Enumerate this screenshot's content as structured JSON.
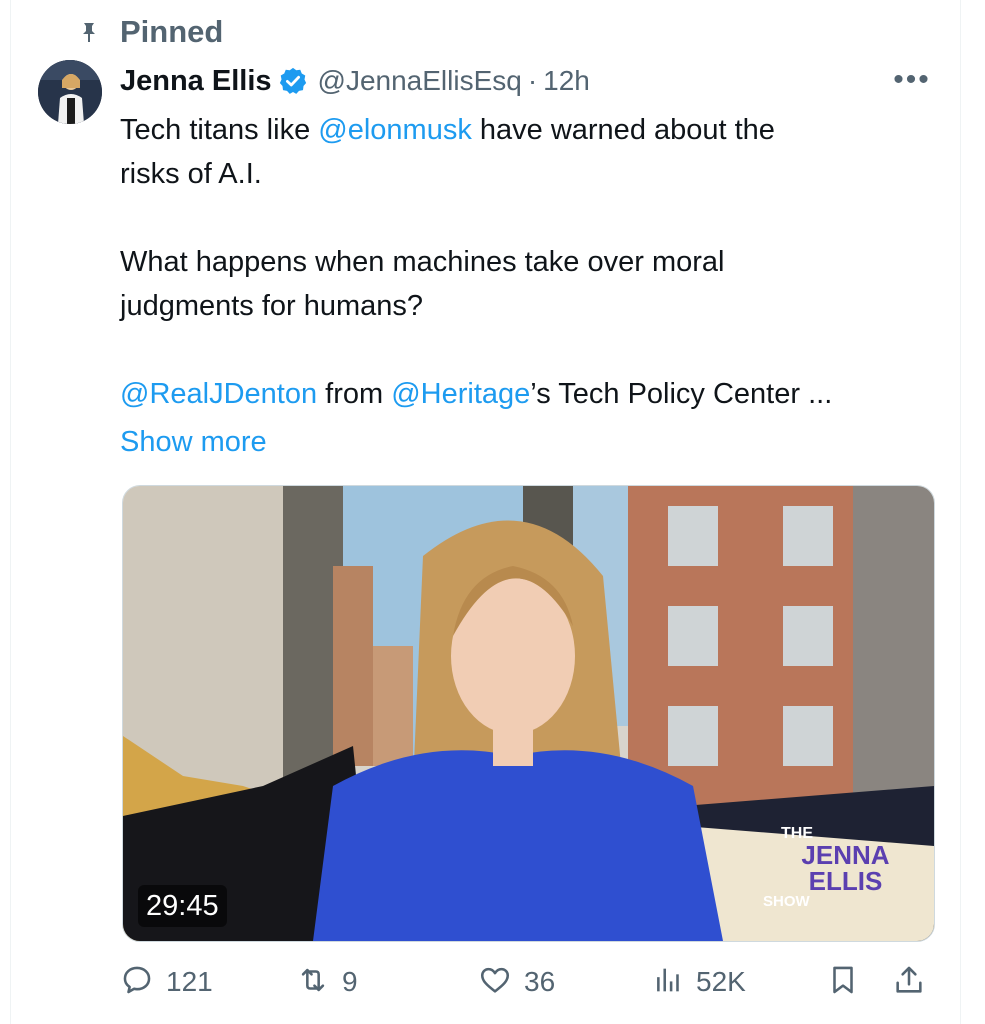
{
  "pinned": {
    "label": "Pinned"
  },
  "tweet": {
    "author_name": "Jenna Ellis",
    "handle": "@JennaEllisEsq",
    "separator": "·",
    "time": "12h",
    "more_label": "•••",
    "text": {
      "l1_pre": "Tech titans like ",
      "l1_mention": "@elonmusk",
      "l1_post": " have warned about the",
      "l2": "risks of A.I.",
      "l3": "What happens when machines take over moral",
      "l4": "judgments for humans?",
      "l5_mention1": "@RealJDenton",
      "l5_mid": " from ",
      "l5_mention2": "@Heritage",
      "l5_post": "’s Tech Policy Center ..."
    },
    "show_more": "Show more",
    "media": {
      "duration": "29:45",
      "logo": {
        "line1": "THE",
        "line2": "JENNA",
        "line3": "ELLIS",
        "line4": "SHOW"
      }
    },
    "actions": {
      "replies": "121",
      "retweets": "9",
      "likes": "36",
      "views": "52K"
    }
  },
  "colors": {
    "accent": "#1d9bf0",
    "secondary_text": "#536471",
    "primary_text": "#0f1419"
  }
}
